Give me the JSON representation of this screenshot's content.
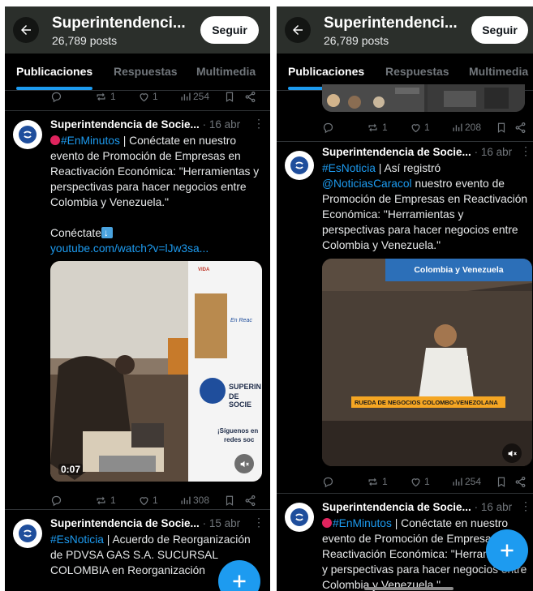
{
  "profile": {
    "title": "Superintendenci...",
    "posts": "26,789 posts",
    "follow_label": "Seguir"
  },
  "tabs": [
    {
      "label": "Publicaciones",
      "active": true
    },
    {
      "label": "Respuestas",
      "active": false
    },
    {
      "label": "Multimedia",
      "active": false
    }
  ],
  "colors": {
    "accent": "#1d9bf0",
    "background": "#000000",
    "header": "#2b2f2b",
    "muted": "#71767b"
  },
  "left": {
    "top_actions": {
      "reposts": "1",
      "likes": "1",
      "views": "254"
    },
    "tweets": [
      {
        "name": "Superintendencia de Socie...",
        "date": "· 16 abr",
        "hashtag": "#EnMinutos",
        "text": " | Conéctate en nuestro evento de Promoción de Empresas en Reactivación Económica: \"Herramientas y perspectivas para hacer negocios entre Colombia y Venezuela.\"",
        "cta": "Conéctate",
        "link": "youtube.com/watch?v=lJw3sa...",
        "video_time": "0:07",
        "banner_text_1": "SUPERIN",
        "banner_text_2": "DE SOCIE",
        "banner_text_3": "En Reac",
        "banner_text_4": "¡Síguenos en",
        "banner_text_5": "redes soc",
        "banner_brand": "VIDA",
        "actions": {
          "reposts": "1",
          "likes": "1",
          "views": "308"
        }
      },
      {
        "name": "Superintendencia de Socie...",
        "date": "· 15 abr",
        "hashtag": "#EsNoticia",
        "text": " | Acuerdo de Reorganización de PDVSA GAS S.A. SUCURSAL COLOMBIA en Reorganización"
      }
    ]
  },
  "right": {
    "top_actions": {
      "reposts": "1",
      "likes": "1",
      "views": "208"
    },
    "tweets": [
      {
        "name": "Superintendencia de Socie...",
        "date": "· 16 abr",
        "hashtag": "#EsNoticia",
        "text_1": " | Así registró ",
        "mention": "@NoticiasCaracol",
        "text_2": " nuestro evento de Promoción de Empresas en Reactivación Económica: \"Herramientas y perspectivas para hacer negocios entre Colombia y Venezuela.\"",
        "video_banner": "Colombia y Venezuela",
        "video_caption": "RUEDA DE NEGOCIOS COLOMBO-VENEZOLANA",
        "actions": {
          "reposts": "1",
          "likes": "1",
          "views": "254"
        }
      },
      {
        "name": "Superintendencia de Socie...",
        "date": "· 16 abr",
        "hashtag": "#EnMinutos",
        "text": " | Conéctate en nuestro evento de Promoción de Empresas en Reactivación Económica: \"Herramientas y perspectivas para hacer negocios entre Colombia y Venezuela.\""
      }
    ]
  },
  "icons": [
    "back-arrow-icon",
    "reply-icon",
    "repost-icon",
    "like-icon",
    "views-icon",
    "bookmark-icon",
    "share-icon",
    "mute-icon",
    "plus-icon",
    "more-icon",
    "logo-icon"
  ]
}
